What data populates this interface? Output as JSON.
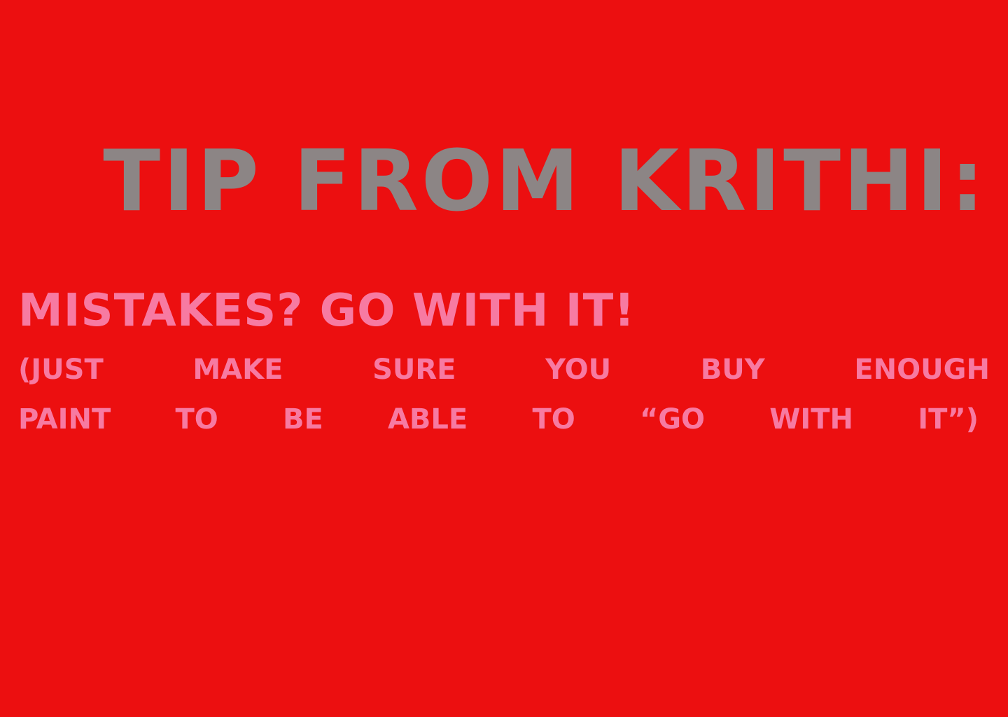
{
  "colors": {
    "background": "#ec0f10",
    "title": "#8c8585",
    "body_text": "#f77aa2"
  },
  "title": "TIP FROM KRITHI:",
  "subtitle": "MISTAKES? GO WITH IT!",
  "note": {
    "line1": [
      "(JUST",
      "MAKE",
      "SURE",
      "YOU",
      "BUY",
      "ENOUGH"
    ],
    "line2": [
      "PAINT",
      "TO",
      "BE",
      "ABLE",
      "TO",
      "“GO",
      "WITH",
      "IT”)"
    ]
  }
}
